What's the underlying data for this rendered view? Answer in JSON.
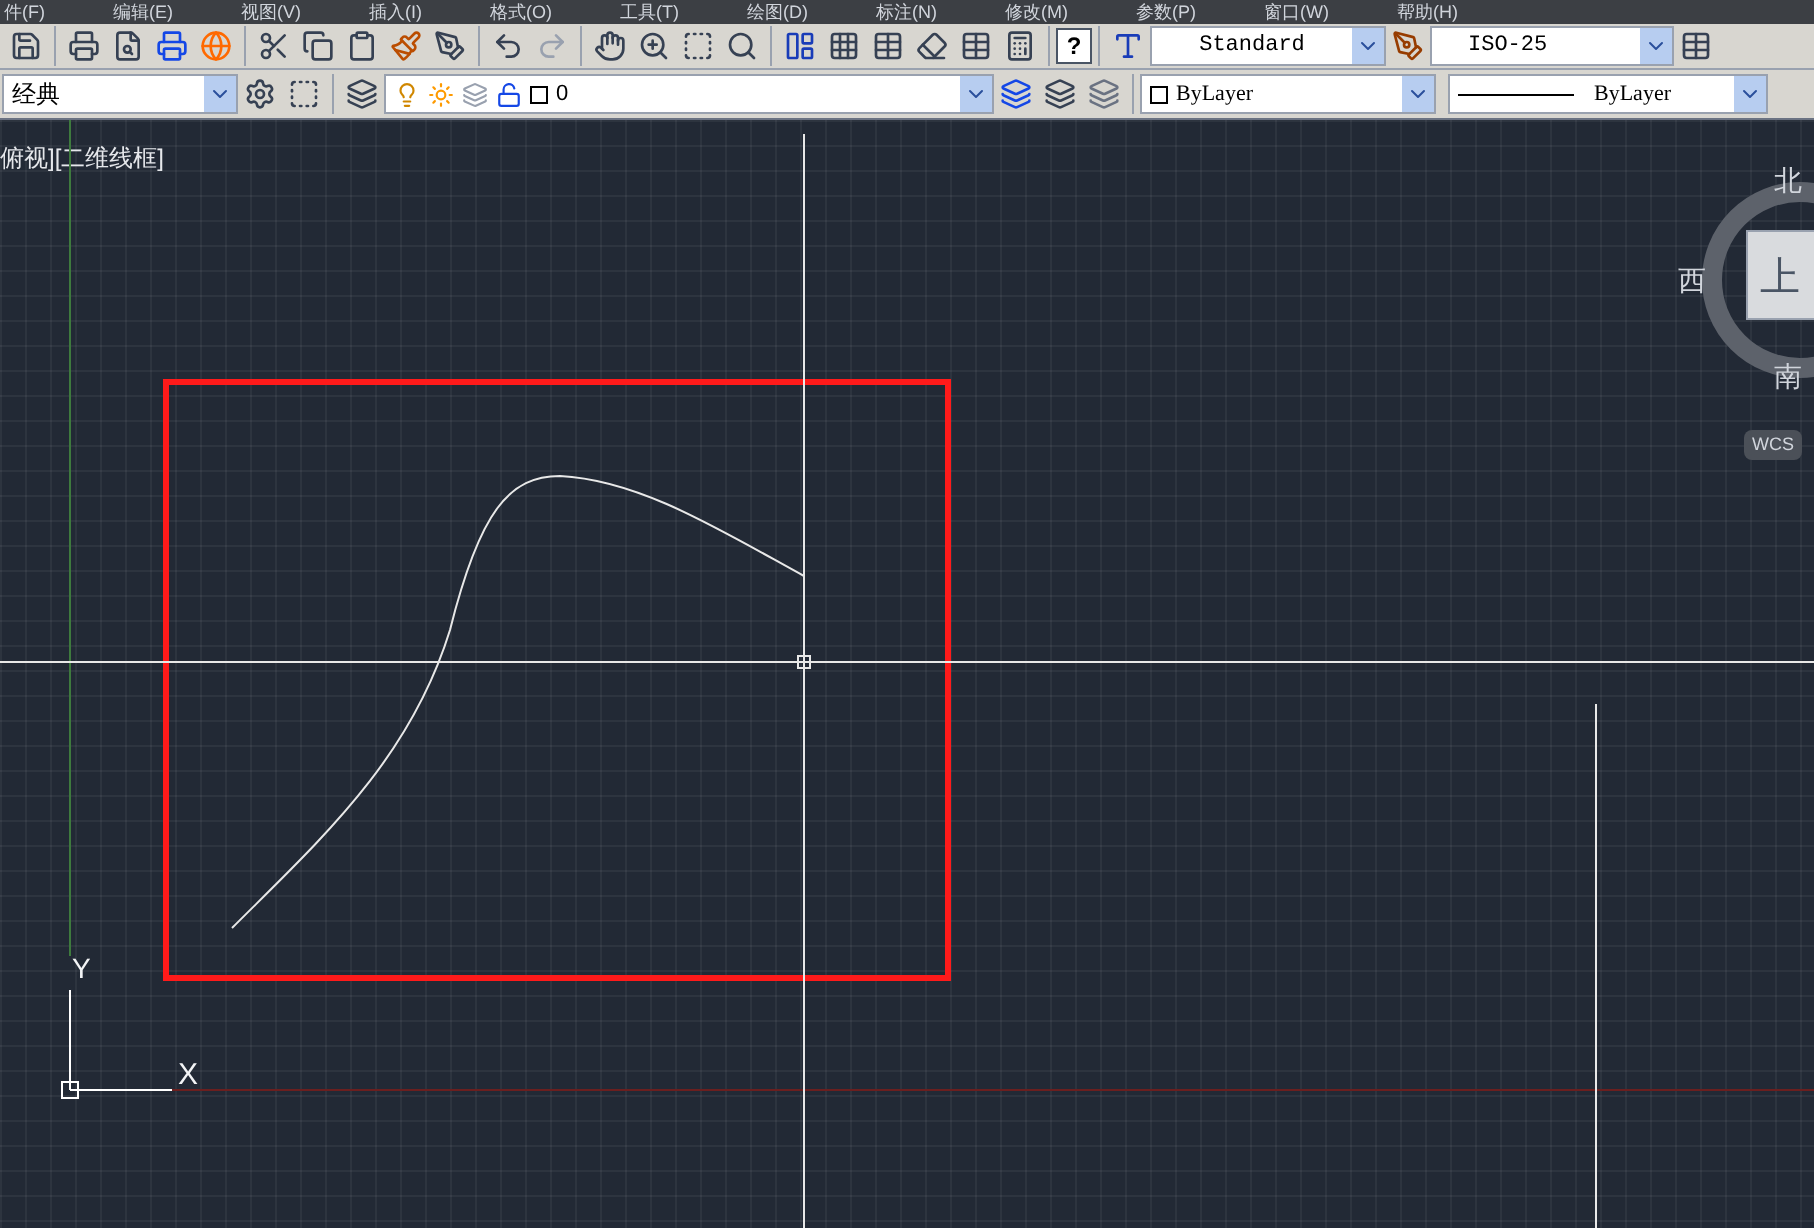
{
  "menu_bar": {
    "items": [
      "件(F)",
      "编辑(E)",
      "视图(V)",
      "插入(I)",
      "格式(O)",
      "工具(T)",
      "绘图(D)",
      "标注(N)",
      "修改(M)",
      "参数(P)",
      "窗口(W)",
      "帮助(H)"
    ]
  },
  "standard_toolbar": {
    "help_glyph": "?",
    "text_style": "Standard",
    "dim_style": "ISO-25"
  },
  "layers_toolbar": {
    "workspace": "经典",
    "layer": "0",
    "color_setting": "ByLayer",
    "linetype": "ByLayer"
  },
  "viewport": {
    "label": "俯视][二维线框]"
  },
  "viewcube": {
    "north": "北",
    "west": "西",
    "south": "南",
    "face": "上",
    "wcs": "WCS"
  },
  "ucs": {
    "x": "X",
    "y": "Y"
  }
}
